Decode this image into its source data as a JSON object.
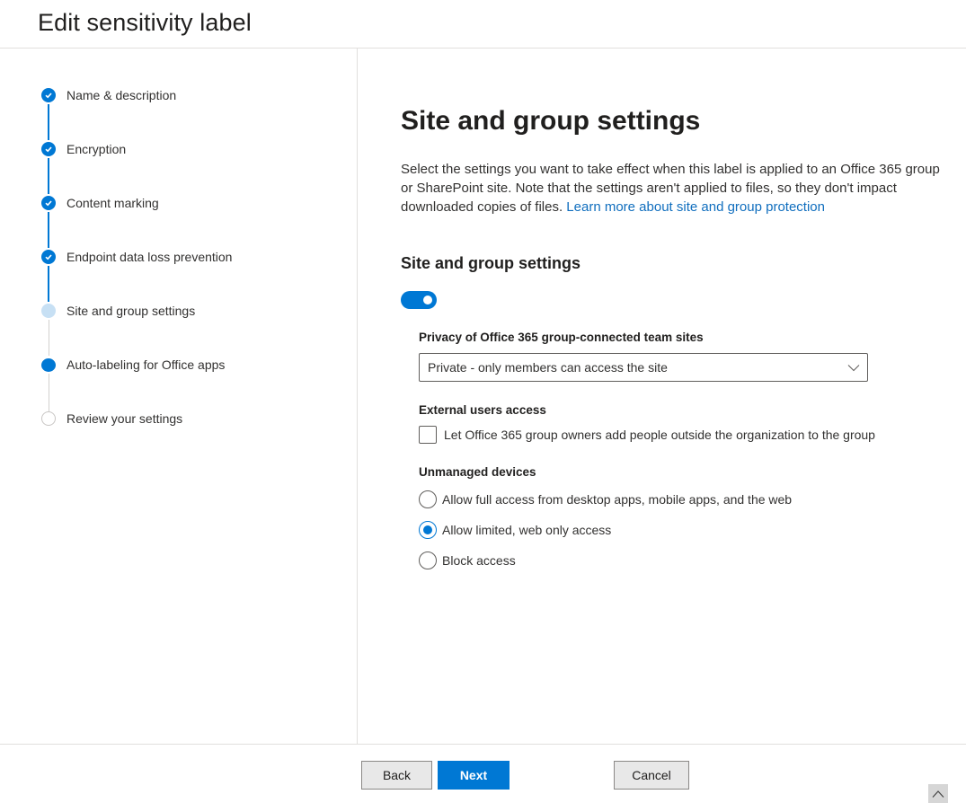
{
  "header": {
    "title": "Edit sensitivity label"
  },
  "wizard": {
    "steps": [
      {
        "label": "Name & description",
        "state": "completed"
      },
      {
        "label": "Encryption",
        "state": "completed"
      },
      {
        "label": "Content marking",
        "state": "completed"
      },
      {
        "label": "Endpoint data loss prevention",
        "state": "completed"
      },
      {
        "label": "Site and group settings",
        "state": "current"
      },
      {
        "label": "Auto-labeling for Office apps",
        "state": "upcoming-active"
      },
      {
        "label": "Review your settings",
        "state": "not-started"
      }
    ]
  },
  "main": {
    "title": "Site and group settings",
    "description": "Select the settings you want to take effect when this label is applied to an Office 365 group or SharePoint site. Note that the settings aren't applied to files, so they don't impact downloaded copies of files.",
    "learn_more_link": "Learn more about site and group protection",
    "section_title": "Site and group settings",
    "toggle_on": true,
    "privacy": {
      "label": "Privacy of Office 365 group-connected team sites",
      "selected": "Private - only members can access the site"
    },
    "external_access": {
      "label": "External users access",
      "checkbox_label": "Let Office 365 group owners add people outside the organization to the group",
      "checked": false
    },
    "unmanaged_devices": {
      "label": "Unmanaged devices",
      "options": [
        {
          "label": "Allow full access from desktop apps, mobile apps, and the web",
          "selected": false
        },
        {
          "label": "Allow limited, web only access",
          "selected": true
        },
        {
          "label": "Block access",
          "selected": false
        }
      ]
    }
  },
  "footer": {
    "back_label": "Back",
    "next_label": "Next",
    "cancel_label": "Cancel"
  },
  "colors": {
    "accent": "#0078d4",
    "link": "#106ebe",
    "current_step": "#c7e0f4"
  }
}
